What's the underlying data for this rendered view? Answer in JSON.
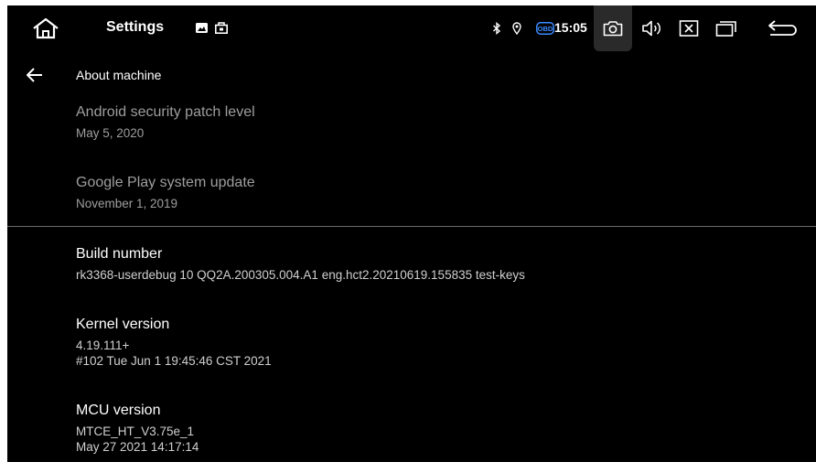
{
  "statusbar": {
    "app_title": "Settings",
    "clock": "15:05",
    "obd_label": "OBD",
    "icons": [
      "home-icon",
      "image-icon",
      "briefcase-icon",
      "bluetooth-icon",
      "location-icon",
      "obd-icon",
      "camera-icon",
      "volume-icon",
      "close-box-icon",
      "recent-apps-icon",
      "back-return-icon"
    ]
  },
  "header": {
    "title": "About machine"
  },
  "items": [
    {
      "title": "Android security patch level",
      "subtitle": "May 5, 2020"
    },
    {
      "title": "Google Play system update",
      "subtitle": "November 1, 2019"
    },
    {
      "title": "Build number",
      "subtitle": "rk3368-userdebug 10 QQ2A.200305.004.A1 eng.hct2.20210619.155835 test-keys"
    },
    {
      "title": "Kernel version",
      "subtitle": "4.19.111+\n#102 Tue Jun 1 19:45:46 CST 2021"
    },
    {
      "title": "MCU version",
      "subtitle": "MTCE_HT_V3.75e_1\nMay 27 2021 14:17:14"
    }
  ],
  "colors": {
    "background": "#000000",
    "text": "#ffffff",
    "dim_text": "#9e9e9e",
    "obd_accent": "#3a8bff"
  }
}
